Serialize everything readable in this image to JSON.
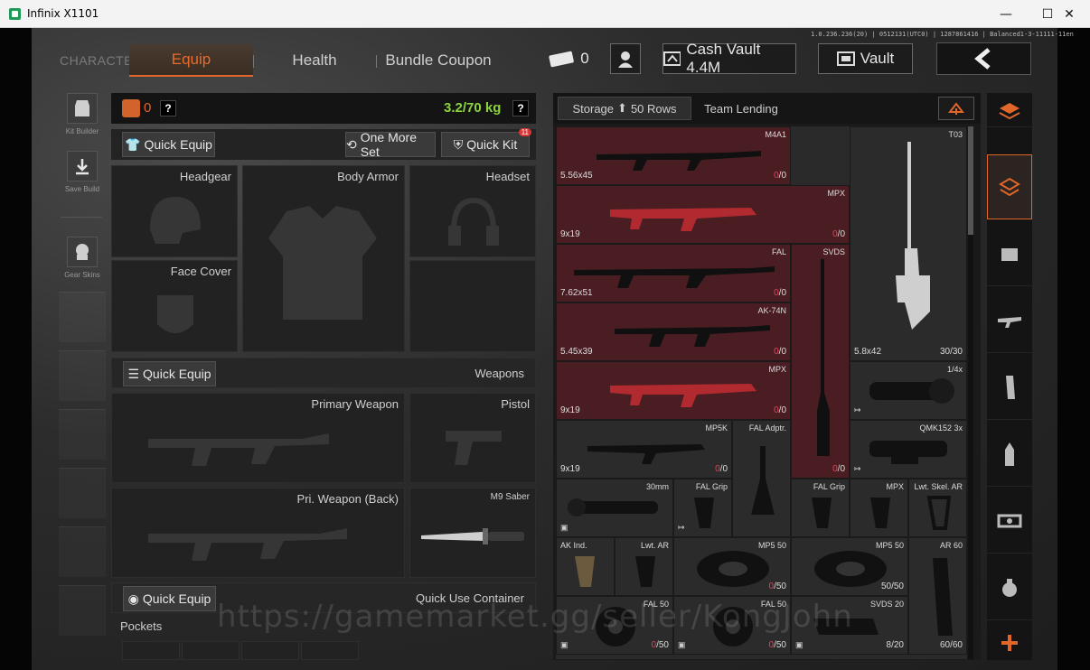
{
  "window": {
    "title": "Infinix X1101",
    "min": "—",
    "max": "☐",
    "close": "✕"
  },
  "header": {
    "character_label": "CHARACTER",
    "tabs": [
      {
        "label": "Equip",
        "active": true
      },
      {
        "label": "Health",
        "active": false
      },
      {
        "label": "Bundle Coupon",
        "active": false
      }
    ],
    "ticket_count": "0",
    "cash_vault": "Cash Vault 4.4M",
    "vault": "Vault",
    "version": "1.0.236.236(20) | 0512131(UTC0) | 1287861416 | Balanced1-3-11111-11en"
  },
  "rail": {
    "kit_builder": "Kit Builder",
    "save_build": "Save Build",
    "gear_skins": "Gear Skins"
  },
  "equip": {
    "vest_count": "0",
    "help": "?",
    "weight": "3.2/70 kg",
    "quick_equip": "Quick Equip",
    "one_more_set": "One More Set",
    "quick_kit": "Quick Kit",
    "quick_kit_badge": "11",
    "slots": {
      "headgear": "Headgear",
      "body_armor": "Body Armor",
      "headset": "Headset",
      "face_cover": "Face Cover"
    },
    "weapons_section": "Weapons",
    "primary_weapon": "Primary Weapon",
    "pistol": "Pistol",
    "pri_weapon_back": "Pri. Weapon (Back)",
    "melee": "M9 Saber",
    "quick_use_section": "Quick Use Container",
    "pockets": "Pockets"
  },
  "storage": {
    "tab_storage": "Storage",
    "rows": "50 Rows",
    "tab_team": "Team Lending",
    "items": [
      {
        "name": "M4A1",
        "cal": "5.56x45",
        "cur": "0",
        "max": "0"
      },
      {
        "name": "T03",
        "cal": "5.8x42",
        "cur": "30",
        "max": "30"
      },
      {
        "name": "MPX",
        "cal": "9x19",
        "cur": "0",
        "max": "0"
      },
      {
        "name": "FAL",
        "cal": "7.62x51",
        "cur": "0",
        "max": "0"
      },
      {
        "name": "SVDS",
        "cal": "",
        "cur": "0",
        "max": "0"
      },
      {
        "name": "AK-74N",
        "cal": "5.45x39",
        "cur": "0",
        "max": "0"
      },
      {
        "name": "MPX",
        "cal": "9x19",
        "cur": "0",
        "max": "0"
      },
      {
        "name": "1/4x",
        "cal": "",
        "cur": "",
        "max": ""
      },
      {
        "name": "MP5K",
        "cal": "9x19",
        "cur": "0",
        "max": "0"
      },
      {
        "name": "FAL Adptr.",
        "cal": "",
        "cur": "",
        "max": ""
      },
      {
        "name": "QMK152 3x",
        "cal": "",
        "cur": "",
        "max": ""
      },
      {
        "name": "30mm",
        "cal": "",
        "cur": "",
        "max": ""
      },
      {
        "name": "FAL Grip",
        "cal": "",
        "cur": "",
        "max": ""
      },
      {
        "name": "FAL Grip",
        "cal": "",
        "cur": "",
        "max": ""
      },
      {
        "name": "MPX",
        "cal": "",
        "cur": "",
        "max": ""
      },
      {
        "name": "Lwt. Skel. AR",
        "cal": "",
        "cur": "",
        "max": ""
      },
      {
        "name": "AK Ind.",
        "cal": "",
        "cur": "",
        "max": ""
      },
      {
        "name": "Lwt. AR",
        "cal": "",
        "cur": "",
        "max": ""
      },
      {
        "name": "MP5 50",
        "cal": "",
        "cur": "0",
        "max": "50"
      },
      {
        "name": "MP5 50",
        "cal": "",
        "cur": "50",
        "max": "50"
      },
      {
        "name": "AR 60",
        "cal": "",
        "cur": "60",
        "max": "60"
      },
      {
        "name": "FAL 50",
        "cal": "",
        "cur": "0",
        "max": "50"
      },
      {
        "name": "FAL 50",
        "cal": "",
        "cur": "0",
        "max": "50"
      },
      {
        "name": "SVDS 20",
        "cal": "",
        "cur": "8",
        "max": "20"
      }
    ]
  },
  "watermark": "https://gamemarket.gg/seller/KongJohn",
  "colors": {
    "accent": "#e0662a",
    "weight_ok": "#8cd33d",
    "empty_ammo": "#e0465a",
    "highlight": "#4a1d22"
  }
}
